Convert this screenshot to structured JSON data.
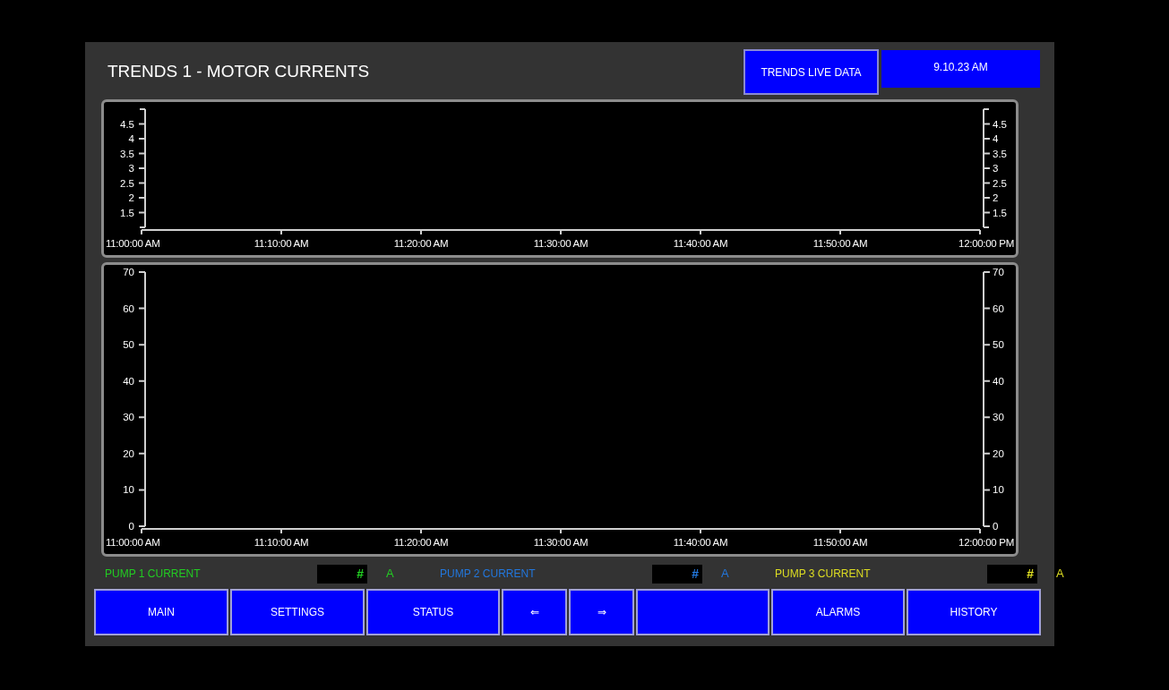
{
  "header": {
    "title": "TRENDS 1 - MOTOR CURRENTS",
    "live_button": "TRENDS LIVE DATA",
    "clock": "9.10.23 AM"
  },
  "charts": [
    {
      "chart_data": {
        "type": "line",
        "ylim": [
          1,
          5
        ],
        "yticks": [
          1.5,
          2,
          2.5,
          3,
          3.5,
          4,
          4.5
        ],
        "categories": [
          "11:00:00 AM",
          "11:10:00 AM",
          "11:20:00 AM",
          "11:30:00 AM",
          "11:40:00 AM",
          "11:50:00 AM",
          "12:00:00 PM"
        ]
      },
      "right_axis_labels": [
        "4.5",
        "4",
        "3.5",
        "3",
        "2.5",
        "2",
        "1.5"
      ]
    },
    {
      "chart_data": {
        "type": "line",
        "ylim": [
          0,
          70
        ],
        "yticks": [
          0,
          10,
          20,
          30,
          40,
          50,
          60,
          70
        ],
        "categories": [
          "11:00:00 AM",
          "11:10:00 AM",
          "11:20:00 AM",
          "11:30:00 AM",
          "11:40:00 AM",
          "11:50:00 AM",
          "12:00:00 PM"
        ]
      },
      "right_axis_labels": [
        "70",
        "60",
        "50",
        "40",
        "30",
        "20",
        "10",
        "0"
      ]
    }
  ],
  "readouts": [
    {
      "label": "PUMP 1 CURRENT",
      "value": "#",
      "unit": "A",
      "color": "#22cc22"
    },
    {
      "label": "PUMP 2 CURRENT",
      "value": "#",
      "unit": "A",
      "color": "#2277dd"
    },
    {
      "label": "PUMP 3 CURRENT",
      "value": "#",
      "unit": "A",
      "color": "#dddd22"
    }
  ],
  "nav_buttons": [
    {
      "kind": "text",
      "label": "MAIN"
    },
    {
      "kind": "text",
      "label": "SETTINGS"
    },
    {
      "kind": "text",
      "label": "STATUS"
    },
    {
      "kind": "text",
      "label": "⇐"
    },
    {
      "kind": "text",
      "label": "⇒"
    },
    {
      "kind": "blank"
    },
    {
      "kind": "text",
      "label": "ALARMS"
    },
    {
      "kind": "text",
      "label": "HISTORY"
    }
  ]
}
